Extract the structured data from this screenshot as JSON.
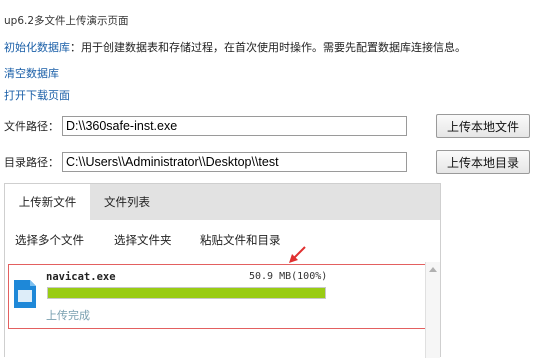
{
  "header": {
    "title": "up6.2多文件上传演示页面",
    "init_link": "初始化数据库",
    "init_desc": "：用于创建数据表和存储过程，在首次使用时操作。需要先配置数据库连接信息。",
    "clear_link": "清空数据库",
    "download_link": "打开下载页面"
  },
  "form": {
    "file_path_label": "文件路径：",
    "file_path_value": "D:\\\\360safe-inst.exe",
    "upload_file_button": "上传本地文件",
    "dir_path_label": "目录路径：",
    "dir_path_value": "C:\\\\Users\\\\Administrator\\\\Desktop\\\\test",
    "upload_dir_button": "上传本地目录"
  },
  "panel": {
    "tabs": [
      "上传新文件",
      "文件列表"
    ],
    "active_tab": "上传新文件",
    "toolbar": [
      "选择多个文件",
      "选择文件夹",
      "粘贴文件和目录"
    ],
    "items": [
      {
        "name": "navicat.exe",
        "size": "50.9 MB(100%)",
        "progress": 1.0,
        "status": "上传完成"
      }
    ]
  },
  "colors": {
    "link": "#1a5fa8",
    "progress": "#99cc14",
    "highlight_border": "#e36060",
    "arrow": "#e03030",
    "file_icon": "#1e88d8"
  },
  "icons": {
    "file": "file-icon",
    "arrow": "red-arrow-annotation-icon",
    "scroll_up": "scroll-up-icon"
  }
}
